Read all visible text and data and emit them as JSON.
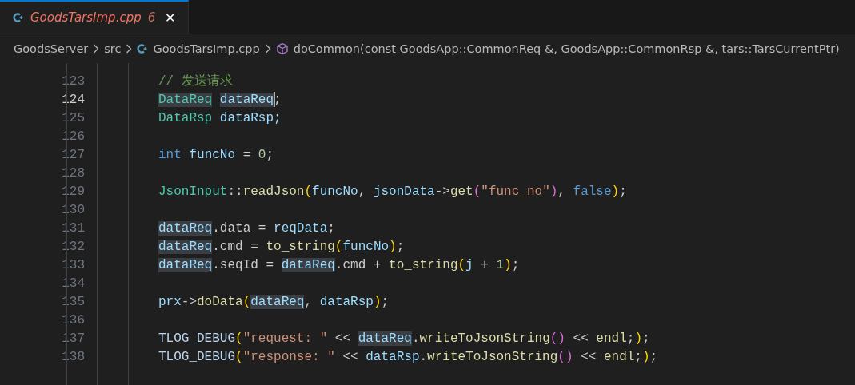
{
  "tabs": [
    {
      "title": "GoodsTarsImp.cpp",
      "problems": "6",
      "close": "✕",
      "selected": true
    }
  ],
  "breadcrumb": [
    {
      "kind": "folder",
      "label": "GoodsServer"
    },
    {
      "kind": "folder",
      "label": "src"
    },
    {
      "kind": "file",
      "label": "GoodsTarsImp.cpp"
    },
    {
      "kind": "method",
      "label": "doCommon(const GoodsApp::CommonReq &, GoodsApp::CommonRsp &, tars::TarsCurrentPtr)"
    }
  ],
  "editor": {
    "lines": [
      {
        "number": "123",
        "current": false,
        "tokens": [
          {
            "text": "// 发送请求",
            "kind": "comment"
          }
        ]
      },
      {
        "number": "124",
        "current": true,
        "tokens": [
          {
            "text": "DataReq",
            "kind": "type",
            "highlighted": true
          },
          {
            "text": "dataReq",
            "kind": "var",
            "highlighted": true,
            "cursor": true,
            "space_before": true
          },
          {
            "text": ";",
            "kind": "plain"
          }
        ]
      },
      {
        "number": "125",
        "current": false,
        "tokens": [
          {
            "text": "DataRsp",
            "kind": "type"
          },
          {
            "text": "dataRsp;",
            "kind": "var",
            "space_before": true
          }
        ]
      },
      {
        "number": "126",
        "current": false
      },
      {
        "number": "127",
        "current": false,
        "tokens": [
          {
            "text": "int",
            "kind": "keyword"
          },
          {
            "text": "funcNo",
            "kind": "var",
            "space_before": true
          },
          {
            "text": "=",
            "kind": "plain",
            "space_before": true
          },
          {
            "text": "0",
            "kind": "number",
            "space_before": true
          },
          {
            "text": ";",
            "kind": "plain"
          }
        ]
      },
      {
        "number": "128",
        "current": false
      },
      {
        "number": "129",
        "current": false,
        "tokens": [
          {
            "text": "JsonInput",
            "kind": "type"
          },
          {
            "text": "::",
            "kind": "plain"
          },
          {
            "text": "readJson",
            "kind": "func"
          },
          {
            "text": "(",
            "kind": "bracket"
          },
          {
            "text": "funcNo",
            "kind": "var"
          },
          {
            "text": ",",
            "kind": "plain"
          },
          {
            "text": "jsonData",
            "kind": "var",
            "space_before": true
          },
          {
            "text": "->",
            "kind": "plain"
          },
          {
            "text": "get",
            "kind": "func"
          },
          {
            "text": "(",
            "kind": "inner_bracket"
          },
          {
            "text": "\"func_no\"",
            "kind": "string"
          },
          {
            "text": ")",
            "kind": "inner_bracket"
          },
          {
            "text": ",",
            "kind": "plain"
          },
          {
            "text": "false",
            "kind": "keyword",
            "space_before": true
          },
          {
            "text": ")",
            "kind": "bracket"
          },
          {
            "text": ";",
            "kind": "plain"
          }
        ]
      },
      {
        "number": "130",
        "current": false
      },
      {
        "number": "131",
        "current": false,
        "tokens": [
          {
            "text": "dataReq",
            "kind": "var",
            "highlighted": true
          },
          {
            "text": ".data =",
            "kind": "plain"
          },
          {
            "text": "reqData",
            "kind": "var",
            "space_before": true
          },
          {
            "text": ";",
            "kind": "plain"
          }
        ]
      },
      {
        "number": "132",
        "current": false,
        "tokens": [
          {
            "text": "dataReq",
            "kind": "var",
            "highlighted": true
          },
          {
            "text": ".cmd =",
            "kind": "plain"
          },
          {
            "text": "to_string",
            "kind": "func",
            "space_before": true
          },
          {
            "text": "(",
            "kind": "bracket"
          },
          {
            "text": "funcNo",
            "kind": "var"
          },
          {
            "text": ")",
            "kind": "bracket"
          },
          {
            "text": ";",
            "kind": "plain"
          }
        ]
      },
      {
        "number": "133",
        "current": false,
        "tokens": [
          {
            "text": "dataReq",
            "kind": "var",
            "highlighted": true
          },
          {
            "text": ".seqId =",
            "kind": "plain"
          },
          {
            "text": "dataReq",
            "kind": "var",
            "highlighted": true,
            "space_before": true
          },
          {
            "text": ".cmd +",
            "kind": "plain"
          },
          {
            "text": "to_string",
            "kind": "func",
            "space_before": true
          },
          {
            "text": "(",
            "kind": "bracket"
          },
          {
            "text": "j",
            "kind": "var"
          },
          {
            "text": "+",
            "kind": "plain",
            "space_before": true
          },
          {
            "text": "1",
            "kind": "number",
            "space_before": true
          },
          {
            "text": ")",
            "kind": "bracket"
          },
          {
            "text": ";",
            "kind": "plain"
          }
        ]
      },
      {
        "number": "134",
        "current": false
      },
      {
        "number": "135",
        "current": false,
        "tokens": [
          {
            "text": "prx",
            "kind": "var"
          },
          {
            "text": "->",
            "kind": "plain"
          },
          {
            "text": "doData",
            "kind": "func"
          },
          {
            "text": "(",
            "kind": "bracket"
          },
          {
            "text": "dataReq",
            "kind": "var",
            "highlighted": true
          },
          {
            "text": ",",
            "kind": "plain"
          },
          {
            "text": "dataRsp",
            "kind": "var",
            "space_before": true
          },
          {
            "text": ")",
            "kind": "bracket"
          },
          {
            "text": ";",
            "kind": "plain"
          }
        ]
      },
      {
        "number": "136",
        "current": false
      },
      {
        "number": "137",
        "current": false,
        "tokens": [
          {
            "text": "TLOG_DEBUG",
            "kind": "macro"
          },
          {
            "text": "(",
            "kind": "bracket"
          },
          {
            "text": "\"request: \"",
            "kind": "string"
          },
          {
            "text": "<<",
            "kind": "plain",
            "space_before": true
          },
          {
            "text": "dataReq",
            "kind": "var",
            "highlighted": true,
            "space_before": true
          },
          {
            "text": ".",
            "kind": "plain"
          },
          {
            "text": "writeToJsonString",
            "kind": "func"
          },
          {
            "text": "()",
            "kind": "inner_bracket"
          },
          {
            "text": "<<",
            "kind": "plain",
            "space_before": true
          },
          {
            "text": "endl",
            "kind": "func",
            "space_before": true
          },
          {
            "text": ";",
            "kind": "plain"
          },
          {
            "text": ")",
            "kind": "bracket"
          },
          {
            "text": ";",
            "kind": "plain"
          }
        ]
      },
      {
        "number": "138",
        "current": false,
        "tokens": [
          {
            "text": "TLOG_DEBUG",
            "kind": "macro"
          },
          {
            "text": "(",
            "kind": "bracket"
          },
          {
            "text": "\"response: \"",
            "kind": "string"
          },
          {
            "text": "<<",
            "kind": "plain",
            "space_before": true
          },
          {
            "text": "dataRsp",
            "kind": "var",
            "space_before": true
          },
          {
            "text": ".",
            "kind": "plain"
          },
          {
            "text": "writeToJsonString",
            "kind": "func"
          },
          {
            "text": "()",
            "kind": "inner_bracket"
          },
          {
            "text": "<<",
            "kind": "plain",
            "space_before": true
          },
          {
            "text": "endl",
            "kind": "func",
            "space_before": true
          },
          {
            "text": ";",
            "kind": "plain"
          },
          {
            "text": ")",
            "kind": "bracket"
          },
          {
            "text": ";",
            "kind": "plain"
          }
        ]
      }
    ]
  }
}
